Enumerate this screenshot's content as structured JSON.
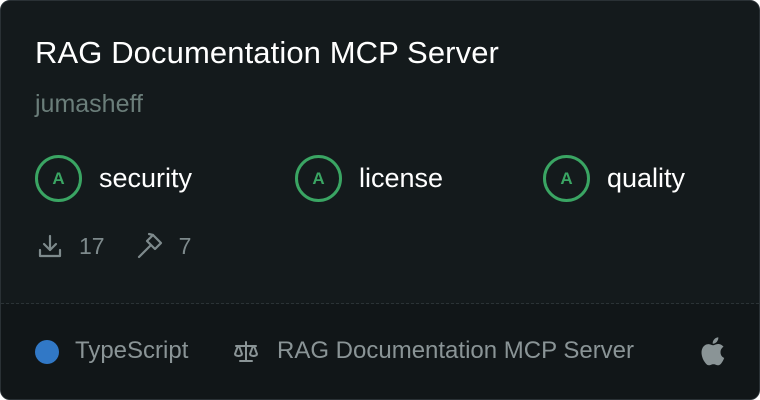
{
  "card": {
    "title": "RAG Documentation MCP Server",
    "author": "jumasheff"
  },
  "grades": [
    {
      "letter": "A",
      "label": "security"
    },
    {
      "letter": "A",
      "label": "license"
    },
    {
      "letter": "A",
      "label": "quality"
    }
  ],
  "stats": {
    "downloads": "17",
    "tools": "7"
  },
  "footer": {
    "language": "TypeScript",
    "license": "RAG Documentation MCP Server",
    "platform_icon": "apple-icon"
  },
  "colors": {
    "background": "#141a1c",
    "grade_green": "#3aa563",
    "typescript_blue": "#3178c6"
  }
}
